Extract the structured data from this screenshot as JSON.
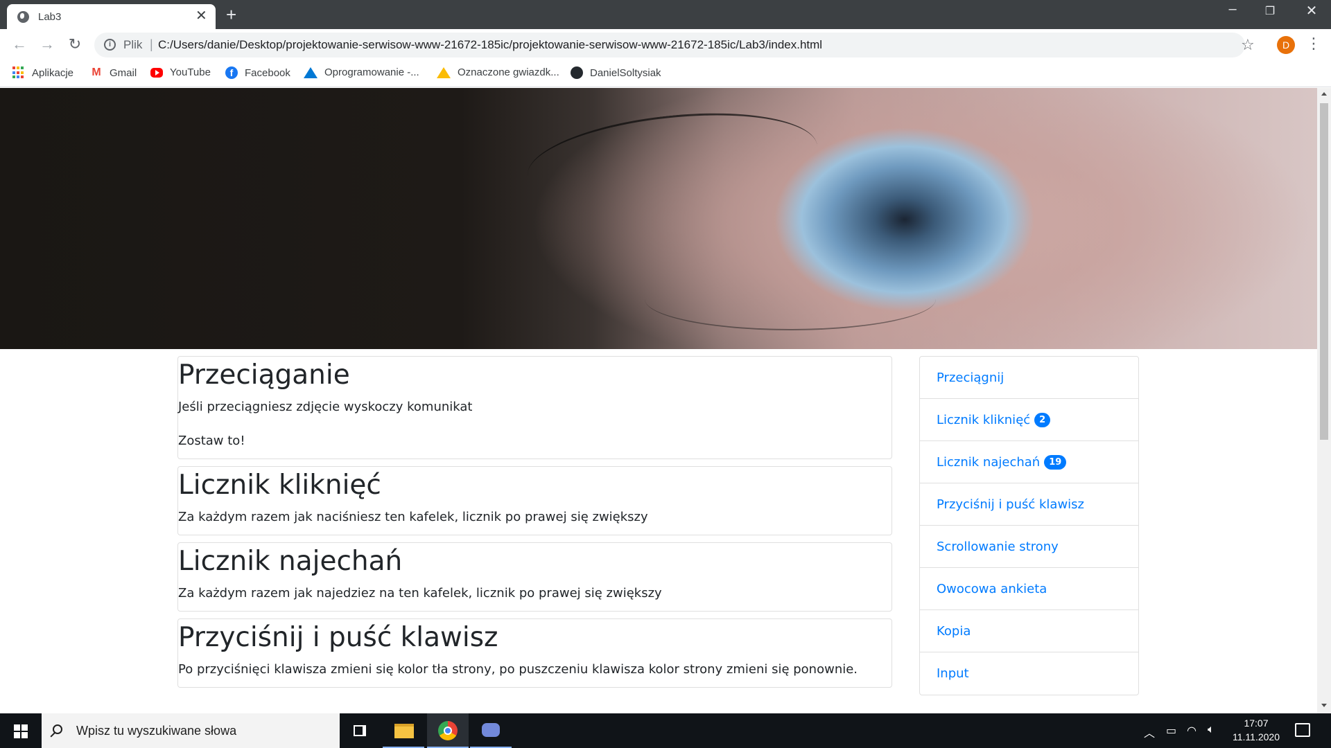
{
  "browser": {
    "tab_title": "Lab3",
    "new_tab_symbol": "+",
    "close_symbol": "✕",
    "address": {
      "scheme_label": "Plik",
      "url": "C:/Users/danie/Desktop/projektowanie-serwisow-www-21672-185ic/projektowanie-serwisow-www-21672-185ic/Lab3/index.html"
    },
    "profile_initial": "D",
    "bookmarks": [
      {
        "label": "Aplikacje",
        "icon": "apps-grid-icon"
      },
      {
        "label": "Gmail",
        "icon": "gmail-icon"
      },
      {
        "label": "YouTube",
        "icon": "youtube-icon"
      },
      {
        "label": "Facebook",
        "icon": "facebook-icon"
      },
      {
        "label": "Oprogramowanie -...",
        "icon": "azure-icon"
      },
      {
        "label": "Oznaczone gwiazdk...",
        "icon": "google-drive-icon"
      },
      {
        "label": "DanielSoltysiak",
        "icon": "github-icon"
      }
    ]
  },
  "page": {
    "sections": [
      {
        "title": "Przeciąganie",
        "paragraphs": [
          "Jeśli przeciągniesz zdjęcie wyskoczy komunikat",
          "Zostaw to!"
        ]
      },
      {
        "title": "Licznik kliknięć",
        "paragraphs": [
          "Za każdym razem jak naciśniesz ten kafelek, licznik po prawej się zwiększy"
        ]
      },
      {
        "title": "Licznik najechań",
        "paragraphs": [
          "Za każdym razem jak najedziez na ten kafelek, licznik po prawej się zwiększy"
        ]
      },
      {
        "title": "Przyciśnij i puść klawisz",
        "paragraphs": [
          "Po przyciśnięci klawisza zmieni się kolor tła strony, po puszczeniu klawisza kolor strony zmieni się ponownie."
        ]
      }
    ],
    "nav": [
      {
        "label": "Przeciągnij",
        "badge": ""
      },
      {
        "label": "Licznik kliknięć",
        "badge": "2"
      },
      {
        "label": "Licznik najechań",
        "badge": "19"
      },
      {
        "label": "Przyciśnij i puść klawisz",
        "badge": ""
      },
      {
        "label": "Scrollowanie strony",
        "badge": ""
      },
      {
        "label": "Owocowa ankieta",
        "badge": ""
      },
      {
        "label": "Kopia",
        "badge": ""
      },
      {
        "label": "Input",
        "badge": ""
      }
    ],
    "colors": {
      "link": "#007bff",
      "badge": "#007bff"
    }
  },
  "taskbar": {
    "search_placeholder": "Wpisz tu wyszukiwane słowa",
    "time": "17:07",
    "date": "11.11.2020"
  }
}
